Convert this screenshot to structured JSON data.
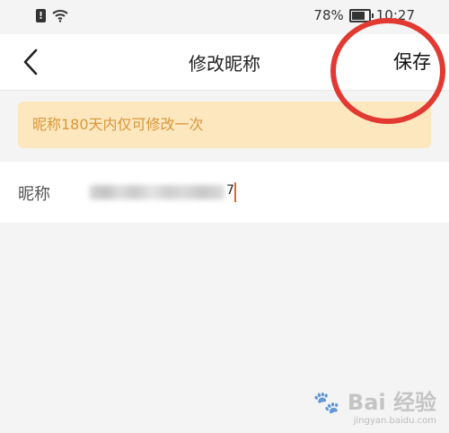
{
  "status_bar": {
    "battery": "78%",
    "time": "10:27"
  },
  "nav": {
    "title": "修改昵称",
    "save_label": "保存"
  },
  "notice": {
    "text": "昵称180天内仅可修改一次"
  },
  "nickname": {
    "label": "昵称",
    "value_suffix": "7"
  },
  "watermark": {
    "brand": "Bai 经验",
    "url": "jingyan.baidu.com"
  },
  "colors": {
    "accent": "#e8622a",
    "notice_bg": "#fde7bf",
    "notice_text": "#d8973a",
    "annotation_circle": "#e23a32"
  },
  "icons": [
    "sim-alert-icon",
    "wifi-icon",
    "battery-icon",
    "back-arrow-icon",
    "paw-icon"
  ]
}
